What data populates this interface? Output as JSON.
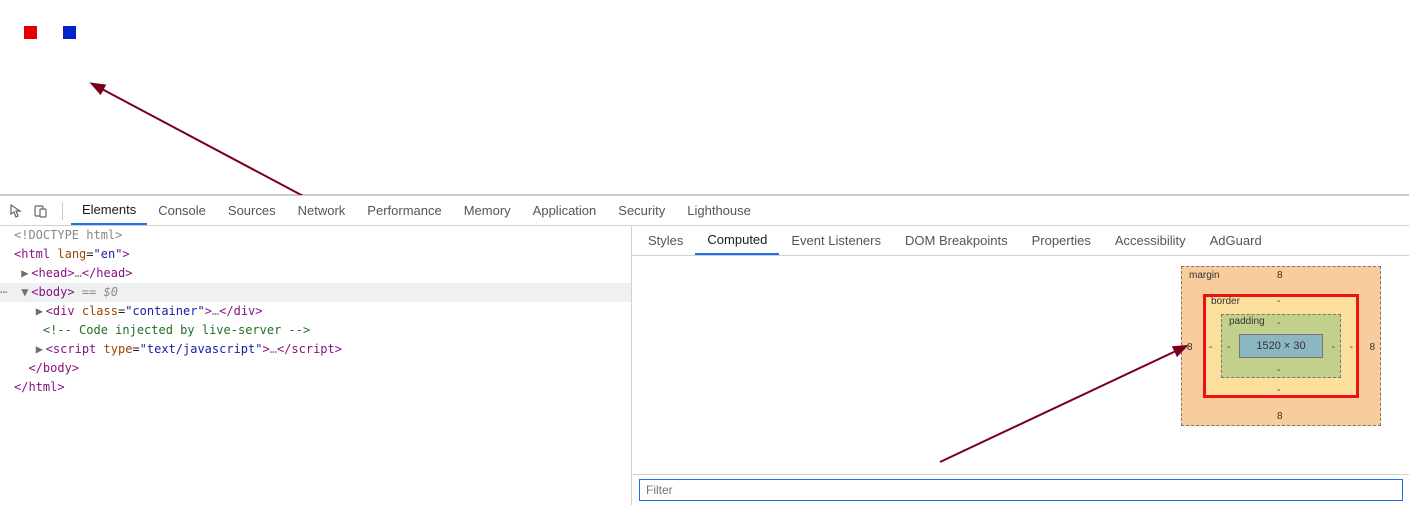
{
  "tabs": {
    "main": [
      "Elements",
      "Console",
      "Sources",
      "Network",
      "Performance",
      "Memory",
      "Application",
      "Security",
      "Lighthouse"
    ],
    "main_active": "Elements",
    "side": [
      "Styles",
      "Computed",
      "Event Listeners",
      "DOM Breakpoints",
      "Properties",
      "Accessibility",
      "AdGuard"
    ],
    "side_active": "Computed"
  },
  "dom": {
    "doctype": "<!DOCTYPE html>",
    "html_open": "<html lang=\"en\">",
    "head": "<head>…</head>",
    "body_open": "<body>",
    "body_eq": " == $0",
    "div": "<div class=\"container\">…</div>",
    "comment": "<!-- Code injected by live-server -->",
    "script": "<script type=\"text/javascript\">…</script>",
    "body_close": "</body>",
    "html_close": "</html>"
  },
  "box_model": {
    "labels": {
      "margin": "margin",
      "border": "border",
      "padding": "padding"
    },
    "margin": {
      "top": "8",
      "right": "8",
      "bottom": "8",
      "left": "8"
    },
    "border": {
      "top": "-",
      "right": "-",
      "bottom": "-",
      "left": "-"
    },
    "padding": {
      "top": "-",
      "right": "-",
      "bottom": "-",
      "left": "-"
    },
    "content": "1520 × 30"
  },
  "filter": {
    "placeholder": "Filter"
  }
}
